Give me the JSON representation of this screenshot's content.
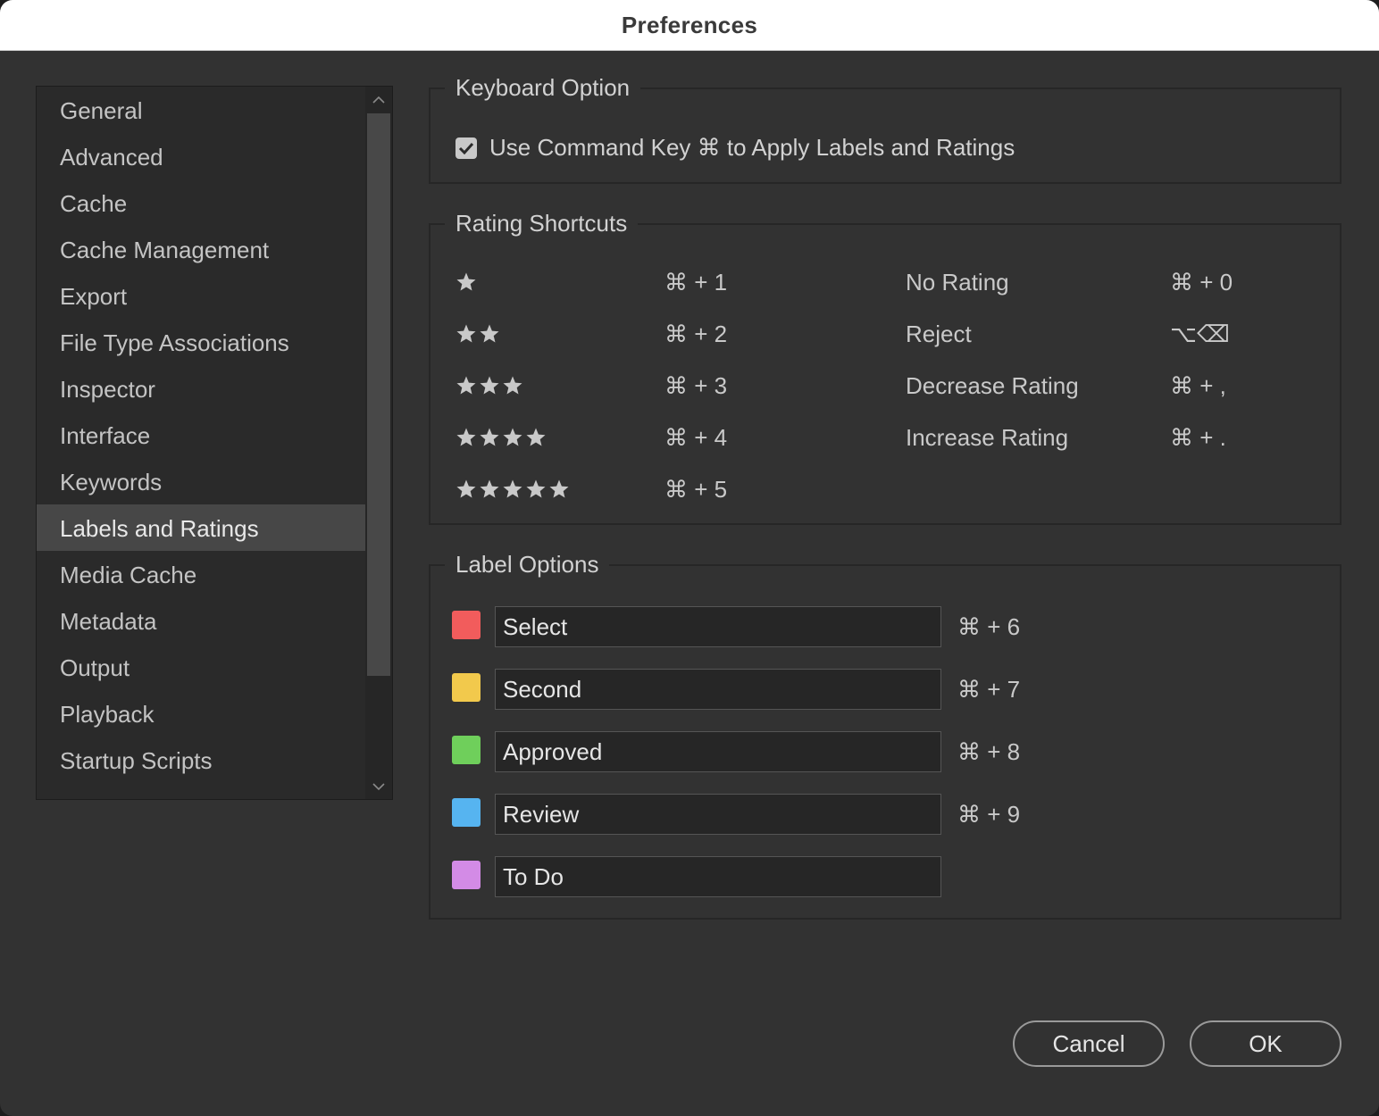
{
  "window": {
    "title": "Preferences"
  },
  "sidebar": {
    "items": [
      {
        "label": "General"
      },
      {
        "label": "Advanced"
      },
      {
        "label": "Cache"
      },
      {
        "label": "Cache Management"
      },
      {
        "label": "Export"
      },
      {
        "label": "File Type Associations"
      },
      {
        "label": "Inspector"
      },
      {
        "label": "Interface"
      },
      {
        "label": "Keywords"
      },
      {
        "label": "Labels and Ratings"
      },
      {
        "label": "Media Cache"
      },
      {
        "label": "Metadata"
      },
      {
        "label": "Output"
      },
      {
        "label": "Playback"
      },
      {
        "label": "Startup Scripts"
      }
    ],
    "selected": "Labels and Ratings"
  },
  "keyboard_option": {
    "title": "Keyboard Option",
    "checkbox_label": "Use Command Key ⌘ to Apply Labels and Ratings",
    "checked": true
  },
  "rating_shortcuts": {
    "title": "Rating Shortcuts",
    "star_ratings": [
      {
        "stars": 1,
        "shortcut": "⌘ + 1"
      },
      {
        "stars": 2,
        "shortcut": "⌘ + 2"
      },
      {
        "stars": 3,
        "shortcut": "⌘ + 3"
      },
      {
        "stars": 4,
        "shortcut": "⌘ + 4"
      },
      {
        "stars": 5,
        "shortcut": "⌘ + 5"
      }
    ],
    "other": [
      {
        "label": "No Rating",
        "shortcut": "⌘ + 0"
      },
      {
        "label": "Reject",
        "shortcut": "⌥⌫"
      },
      {
        "label": "Decrease Rating",
        "shortcut": "⌘ + ,"
      },
      {
        "label": "Increase Rating",
        "shortcut": "⌘ + ."
      }
    ]
  },
  "label_options": {
    "title": "Label Options",
    "labels": [
      {
        "value": "Select",
        "color": "#f25c5c",
        "shortcut": "⌘ + 6"
      },
      {
        "value": "Second",
        "color": "#f2c94c",
        "shortcut": "⌘ + 7"
      },
      {
        "value": "Approved",
        "color": "#6fcf5b",
        "shortcut": "⌘ + 8"
      },
      {
        "value": "Review",
        "color": "#56b4f0",
        "shortcut": "⌘ + 9"
      },
      {
        "value": "To Do",
        "color": "#d38be6",
        "shortcut": ""
      }
    ]
  },
  "buttons": {
    "cancel": "Cancel",
    "ok": "OK"
  }
}
